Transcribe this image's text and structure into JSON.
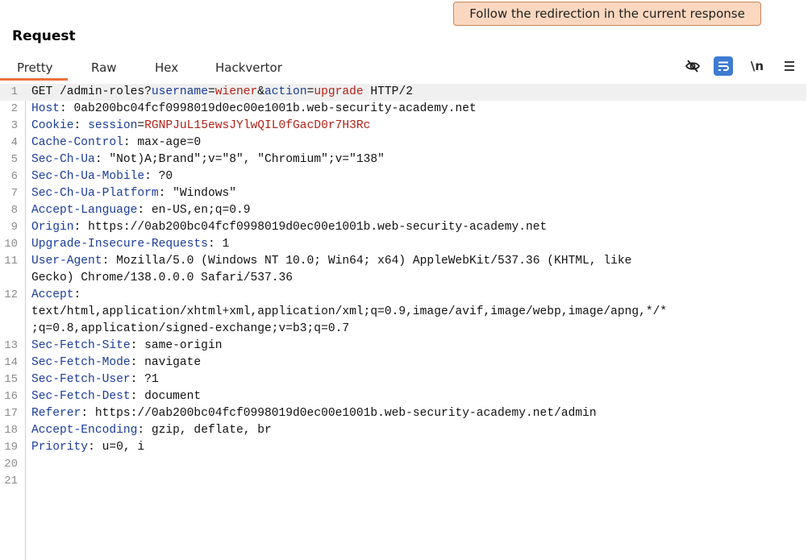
{
  "tooltip": {
    "text": "Follow the redirection in the current response"
  },
  "panel": {
    "title": "Request"
  },
  "tabs": [
    {
      "label": "Pretty",
      "active": true
    },
    {
      "label": "Raw",
      "active": false
    },
    {
      "label": "Hex",
      "active": false
    },
    {
      "label": "Hackvertor",
      "active": false
    }
  ],
  "toolbar": {
    "buttons": [
      {
        "icon": "eye-off-icon"
      },
      {
        "icon": "wrap-lines-icon"
      },
      {
        "icon": "newline-toggle-icon",
        "label": "\\n"
      },
      {
        "icon": "hamburger-menu-icon"
      }
    ]
  },
  "request": {
    "line_numbers": [
      "1",
      "2",
      "3",
      "4",
      "5",
      "6",
      "7",
      "8",
      "9",
      "10",
      "11",
      "",
      "12",
      "",
      "",
      "13",
      "14",
      "15",
      "16",
      "17",
      "18",
      "19",
      "20",
      "21"
    ],
    "request_line": {
      "method_path": "GET /admin-roles?",
      "p1_name": "username",
      "eq1": "=",
      "p1_value": "wiener",
      "amp": "&",
      "p2_name": "action",
      "eq2": "=",
      "p2_value": "upgrade",
      "version": " HTTP/2"
    },
    "cookie": {
      "header": "Cookie",
      "sep": ": ",
      "name": "session",
      "eq": "=",
      "value": "RGNPJuL15ewsJYlwQIL0fGacD0r7H3Rc"
    },
    "headers": [
      {
        "name": "Host",
        "value": "0ab200bc04fcf0998019d0ec00e1001b.web-security-academy.net"
      },
      {
        "name": "Cache-Control",
        "value": "max-age=0"
      },
      {
        "name": "Sec-Ch-Ua",
        "value": "\"Not)A;Brand\";v=\"8\", \"Chromium\";v=\"138\""
      },
      {
        "name": "Sec-Ch-Ua-Mobile",
        "value": "?0"
      },
      {
        "name": "Sec-Ch-Ua-Platform",
        "value": "\"Windows\""
      },
      {
        "name": "Accept-Language",
        "value": "en-US,en;q=0.9"
      },
      {
        "name": "Origin",
        "value": "https://0ab200bc04fcf0998019d0ec00e1001b.web-security-academy.net"
      },
      {
        "name": "Upgrade-Insecure-Requests",
        "value": "1"
      },
      {
        "name": "User-Agent",
        "value": "Mozilla/5.0 (Windows NT 10.0; Win64; x64) AppleWebKit/537.36 (KHTML, like"
      },
      {
        "name": "",
        "value": "Gecko) Chrome/138.0.0.0 Safari/537.36"
      },
      {
        "name": "Accept",
        "value": ""
      },
      {
        "name": "",
        "value": "text/html,application/xhtml+xml,application/xml;q=0.9,image/avif,image/webp,image/apng,*/*"
      },
      {
        "name": "",
        "value": ";q=0.8,application/signed-exchange;v=b3;q=0.7"
      },
      {
        "name": "Sec-Fetch-Site",
        "value": "same-origin"
      },
      {
        "name": "Sec-Fetch-Mode",
        "value": "navigate"
      },
      {
        "name": "Sec-Fetch-User",
        "value": "?1"
      },
      {
        "name": "Sec-Fetch-Dest",
        "value": "document"
      },
      {
        "name": "Referer",
        "value": "https://0ab200bc04fcf0998019d0ec00e1001b.web-security-academy.net/admin"
      },
      {
        "name": "Accept-Encoding",
        "value": "gzip, deflate, br"
      },
      {
        "name": "Priority",
        "value": "u=0, i"
      }
    ]
  }
}
